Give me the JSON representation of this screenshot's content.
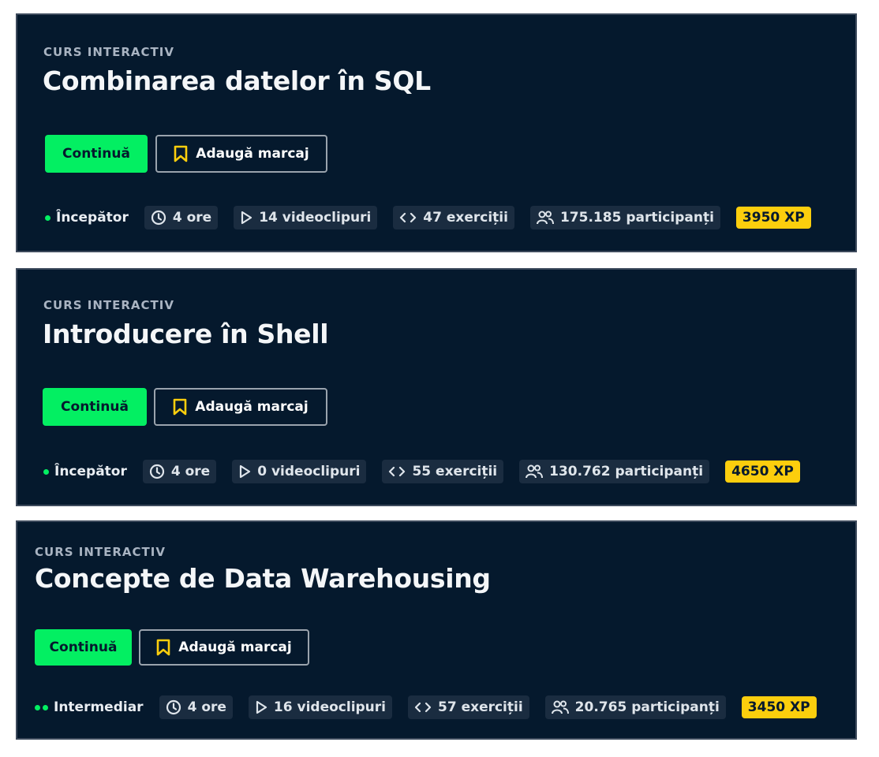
{
  "colors": {
    "card_background": "#05192d",
    "continue_button": "#03ef62",
    "bookmark_icon": "#fcce0d",
    "xp_badge": "#fcce0d",
    "level_dot": "#03ef62"
  },
  "icons": {
    "bookmark": "bookmark-icon",
    "duration": "clock-icon",
    "videos": "play-icon",
    "exercises": "code-icon",
    "participants": "people-icon"
  },
  "cards": [
    {
      "label": "CURS INTERACTIV",
      "title": "Combinarea datelor în SQL",
      "continue_label": "Continuă",
      "bookmark_label": "Adaugă marcaj",
      "level": "Începător",
      "level_dots": 1,
      "duration": "4 ore",
      "videos": "14 videoclipuri",
      "exercises": "47 exerciții",
      "participants": "175.185 participanți",
      "xp": "3950 XP"
    },
    {
      "label": "CURS INTERACTIV",
      "title": "Introducere în Shell",
      "continue_label": "Continuă",
      "bookmark_label": "Adaugă marcaj",
      "level": "Începător",
      "level_dots": 1,
      "duration": "4 ore",
      "videos": "0 videoclipuri",
      "exercises": "55 exerciții",
      "participants": "130.762 participanți",
      "xp": "4650 XP"
    },
    {
      "label": "CURS INTERACTIV",
      "title": "Concepte de Data Warehousing",
      "continue_label": "Continuă",
      "bookmark_label": "Adaugă marcaj",
      "level": "Intermediar",
      "level_dots": 2,
      "duration": "4 ore",
      "videos": "16 videoclipuri",
      "exercises": "57 exerciții",
      "participants": "20.765 participanți",
      "xp": "3450 XP"
    }
  ]
}
